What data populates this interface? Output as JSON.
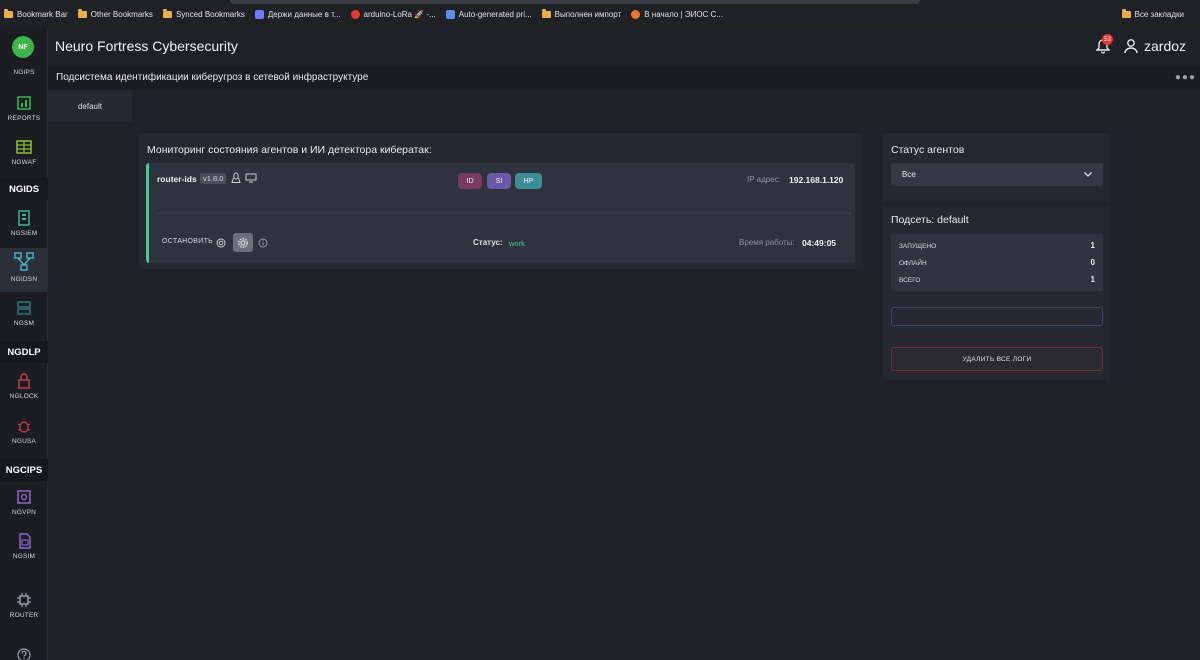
{
  "bookmarks": {
    "items": [
      {
        "label": "Bookmark Bar",
        "icon": "folder-icon"
      },
      {
        "label": "Other Bookmarks",
        "icon": "folder-icon"
      },
      {
        "label": "Synced Bookmarks",
        "icon": "folder-icon"
      },
      {
        "label": "Держи данные в т...",
        "icon": "page-favicon",
        "color": "#6b7cff"
      },
      {
        "label": "arduino-LoRa 🚀 -...",
        "icon": "page-favicon",
        "color": "#e53935"
      },
      {
        "label": "Auto-generated pri...",
        "icon": "page-favicon",
        "color": "#5a8dee"
      },
      {
        "label": "Выполнен импорт",
        "icon": "folder-icon"
      },
      {
        "label": "В начало | ЭИОС С...",
        "icon": "page-favicon",
        "color": "#e8772e"
      }
    ],
    "right": {
      "label": "Все закладки",
      "icon": "folder-icon"
    }
  },
  "sidebar": {
    "logo": "NF",
    "top_label": "NGIPS",
    "sections": [
      {
        "key": "ngids",
        "label": "NGIDS"
      },
      {
        "key": "ngdlp",
        "label": "NGDLP"
      },
      {
        "key": "ngcips",
        "label": "NGCIPS"
      }
    ],
    "items": [
      {
        "key": "reports",
        "label": "REPORTS"
      },
      {
        "key": "ngwaf",
        "label": "NGWAF"
      },
      {
        "key": "ngsiem",
        "label": "NGSIEM"
      },
      {
        "key": "ngidsn",
        "label": "NGIDSN"
      },
      {
        "key": "ngsm",
        "label": "NGSM"
      },
      {
        "key": "nglock",
        "label": "NGLOCK"
      },
      {
        "key": "ngusa",
        "label": "NGUSA"
      },
      {
        "key": "ngvpn",
        "label": "NGVPN"
      },
      {
        "key": "ngsim",
        "label": "NGSIM"
      },
      {
        "key": "router",
        "label": "ROUTER"
      }
    ]
  },
  "header": {
    "title": "Neuro Fortress Cybersecurity",
    "notifications": "53",
    "username": "zardoz"
  },
  "subtitle": "Подсистема идентификации киберугроз в сетевой инфраструктуре",
  "tabs": [
    {
      "label": "default"
    }
  ],
  "monitor": {
    "title": "Мониторинг состояния агентов и ИИ детектора кибератак:",
    "agent": {
      "name": "router-ids",
      "version": "v1.8.0",
      "tags": [
        {
          "label": "ID",
          "color": "#7a3a5e"
        },
        {
          "label": "SI",
          "color": "#6a5aa6"
        },
        {
          "label": "HP",
          "color": "#3d8e97"
        }
      ],
      "ip_label": "IP адрес:",
      "ip": "192.168.1.120",
      "stop_label": "ОСТАНОВИТЬ",
      "status_label": "Статус:",
      "status": "work",
      "uptime_label": "Время работы:",
      "uptime": "04:49:05"
    }
  },
  "agents_status": {
    "title": "Статус агентов",
    "filter_value": "Все",
    "subnet_title": "Подсеть: default",
    "stats": [
      {
        "label": "ЗАПУЩЕНО",
        "value": "1"
      },
      {
        "label": "ОФЛАЙН",
        "value": "0"
      },
      {
        "label": "ВСЕГО",
        "value": "1"
      }
    ],
    "delete_logs_label": "УДАЛИТЬ ВСЕ ЛОГИ"
  },
  "colors": {
    "accent_green": "#3ecf8e",
    "danger": "#e53935"
  }
}
